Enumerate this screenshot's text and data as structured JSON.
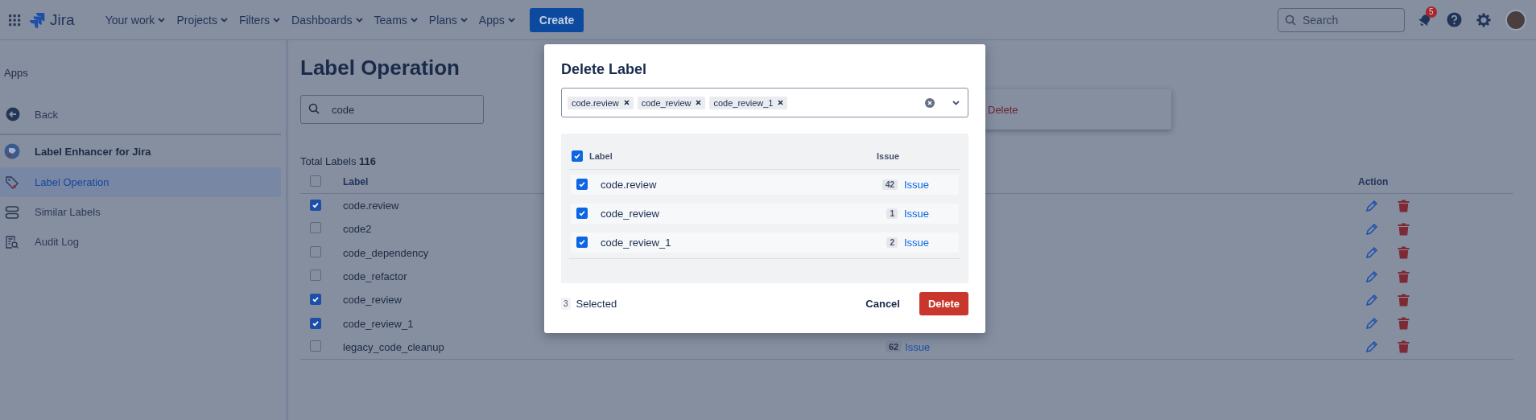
{
  "topbar": {
    "product": "Jira",
    "nav": [
      {
        "label": "Your work",
        "dropdown": true
      },
      {
        "label": "Projects",
        "dropdown": true
      },
      {
        "label": "Filters",
        "dropdown": true
      },
      {
        "label": "Dashboards",
        "dropdown": true
      },
      {
        "label": "Teams",
        "dropdown": true
      },
      {
        "label": "Plans",
        "dropdown": true
      },
      {
        "label": "Apps",
        "dropdown": true
      }
    ],
    "create": "Create",
    "search": {
      "placeholder": "Search"
    },
    "notifications": "5"
  },
  "sidebar": {
    "heading": "Apps",
    "back": "Back",
    "app_name": "Label Enhancer for Jira",
    "items": [
      {
        "label": "Label Operation",
        "selected": true,
        "kind": "tag"
      },
      {
        "label": "Similar Labels",
        "selected": false,
        "kind": "stack"
      },
      {
        "label": "Audit Log",
        "selected": false,
        "kind": "log"
      }
    ]
  },
  "page": {
    "title": "Label Operation",
    "search": {
      "value": "code"
    },
    "menu_item": "Delete",
    "total": "Total Labels **116**",
    "table": {
      "columns": [
        "Label",
        "Action"
      ],
      "select_all": false,
      "rows": [
        {
          "label": "code.review",
          "checked": true
        },
        {
          "label": "code2",
          "checked": false
        },
        {
          "label": "code_dependency",
          "checked": false
        },
        {
          "label": "code_refactor",
          "checked": false
        },
        {
          "label": "code_review",
          "checked": true
        },
        {
          "label": "code_review_1",
          "checked": true
        },
        {
          "label": "legacy_code_cleanup",
          "checked": false,
          "count": "62",
          "issue": "Issue"
        }
      ]
    }
  },
  "dialog": {
    "title": "Delete Label",
    "tags": [
      "code.review",
      "code_review",
      "code_review_1"
    ],
    "table": {
      "columns": [
        "Label",
        "Issue"
      ],
      "select_all": true,
      "rows": [
        {
          "label": "code.review",
          "checked": true,
          "count": "42",
          "issue": "Issue"
        },
        {
          "label": "code_review",
          "checked": true,
          "count": "1",
          "issue": "Issue"
        },
        {
          "label": "code_review_1",
          "checked": true,
          "count": "2",
          "issue": "Issue"
        }
      ]
    },
    "selected_count": "3",
    "selected_text": "Selected",
    "cancel": "Cancel",
    "confirm": "Delete"
  }
}
